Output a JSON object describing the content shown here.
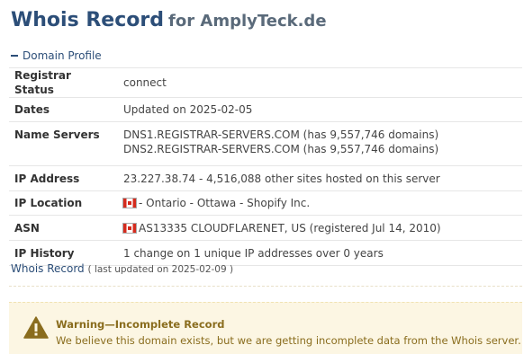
{
  "header": {
    "title": "Whois Record",
    "subtitle": "for AmplyTeck.de"
  },
  "section": {
    "toggle_label": "Domain Profile"
  },
  "profile": {
    "rows": [
      {
        "label": "Registrar Status",
        "value": "connect"
      },
      {
        "label": "Dates",
        "value": "Updated on 2025-02-05"
      },
      {
        "label": "Name Servers",
        "value_line1": "DNS1.REGISTRAR-SERVERS.COM (has 9,557,746 domains)",
        "value_line2": "DNS2.REGISTRAR-SERVERS.COM (has 9,557,746 domains)"
      },
      {
        "label": "IP Address",
        "value": "23.227.38.74 - 4,516,088 other sites hosted on this server"
      },
      {
        "label": "IP Location",
        "value": "- Ontario - Ottawa - Shopify Inc.",
        "flag": "canada-flag-icon"
      },
      {
        "label": "ASN",
        "value": "AS13335 CLOUDFLARENET, US (registered Jul 14, 2010)",
        "flag": "canada-flag-icon"
      },
      {
        "label": "IP History",
        "value": "1 change on 1 unique IP addresses over 0 years"
      }
    ]
  },
  "whois": {
    "link_label": "Whois Record",
    "last_updated": "( last updated on 2025-02-09 )"
  },
  "warning": {
    "icon": "warning-triangle-icon",
    "title": "Warning—Incomplete Record",
    "message": "We believe this domain exists, but we are getting incomplete data from the Whois server."
  },
  "colors": {
    "heading": "#2c4e78",
    "warning_bg": "#fcf6e3",
    "warning_text": "#8a6d1e",
    "warning_icon": "#8a6d1e"
  }
}
